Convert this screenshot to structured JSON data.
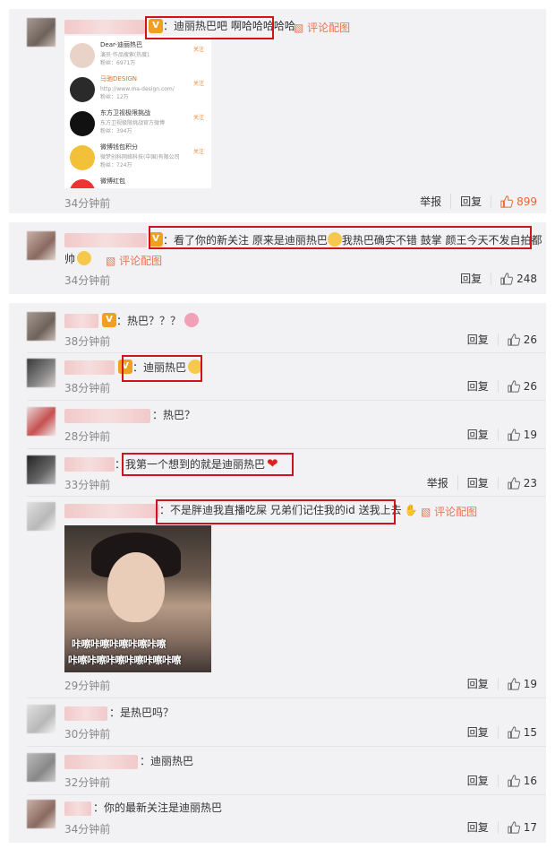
{
  "comments": [
    {
      "text": "：迪丽热巴吧 啊哈哈哈哈哈",
      "pic_link": "评论配图",
      "time": "34分钟前",
      "report": "举报",
      "reply": "回复",
      "likes": "899"
    },
    {
      "text_line1": "：看了你的新关注 原来是迪丽热巴",
      "text_line1b": "我热巴确实不错 鼓掌 颜王今天不发自拍都",
      "text_line2": "帅",
      "pic_link": "评论配图",
      "time": "34分钟前",
      "reply": "回复",
      "likes": "248"
    }
  ],
  "screenshot_items": [
    {
      "title": "Dear-迪丽热巴 ",
      "sub": "演员·作品搜索(热度)",
      "sub2": "粉丝：6971万",
      "follow": "关注"
    },
    {
      "title": "马驰DESIGN ",
      "sub": "http://www.ma-design.com/",
      "sub2": "粉丝：12万",
      "follow": "关注"
    },
    {
      "title": "东方卫视极限挑战",
      "sub": "东方卫视极限挑战官方微博",
      "sub2": "粉丝：394万",
      "follow": "关注"
    },
    {
      "title": "微博钱包积分",
      "sub": "微梦创科网络科技(中国)有限公司",
      "sub2": "粉丝：724万",
      "follow": "关注"
    },
    {
      "title": "微博红包",
      "sub": "",
      "sub2": "",
      "follow": ""
    }
  ],
  "replies": [
    {
      "text": "：热巴？？？",
      "time": "38分钟前",
      "reply": "回复",
      "likes": "26"
    },
    {
      "text": "：迪丽热巴",
      "time": "38分钟前",
      "reply": "回复",
      "likes": "26"
    },
    {
      "text": "：热巴？",
      "time": "28分钟前",
      "reply": "回复",
      "likes": "19"
    },
    {
      "text": "：我第一个想到的就是迪丽热巴",
      "time": "33分钟前",
      "report": "举报",
      "reply": "回复",
      "likes": "23"
    },
    {
      "text": "：不是胖迪我直播吃屎 兄弟们记住我的id 送我上去",
      "pic_link": "评论配图",
      "image_caption_1": "咔嚓咔嚓咔嚓咔嚓咔嚓",
      "image_caption_2": "咔嚓咔嚓咔嚓咔嚓咔嚓咔嚓",
      "time": "29分钟前",
      "reply": "回复",
      "likes": "19"
    },
    {
      "text": "：是热巴吗？",
      "time": "30分钟前",
      "reply": "回复",
      "likes": "15"
    },
    {
      "text": "：迪丽热巴",
      "time": "32分钟前",
      "reply": "回复",
      "likes": "16"
    },
    {
      "text": "：你的最新关注是迪丽热巴",
      "time": "34分钟前",
      "reply": "回复",
      "likes": "17"
    }
  ],
  "colors": {
    "highlight_border": "#d0141c",
    "like_hot": "#e8662b",
    "pic_link": "#eb7350"
  },
  "icons": {
    "like": "thumb-up-icon",
    "picture": "image-icon",
    "vip": "vip-badge-icon"
  }
}
